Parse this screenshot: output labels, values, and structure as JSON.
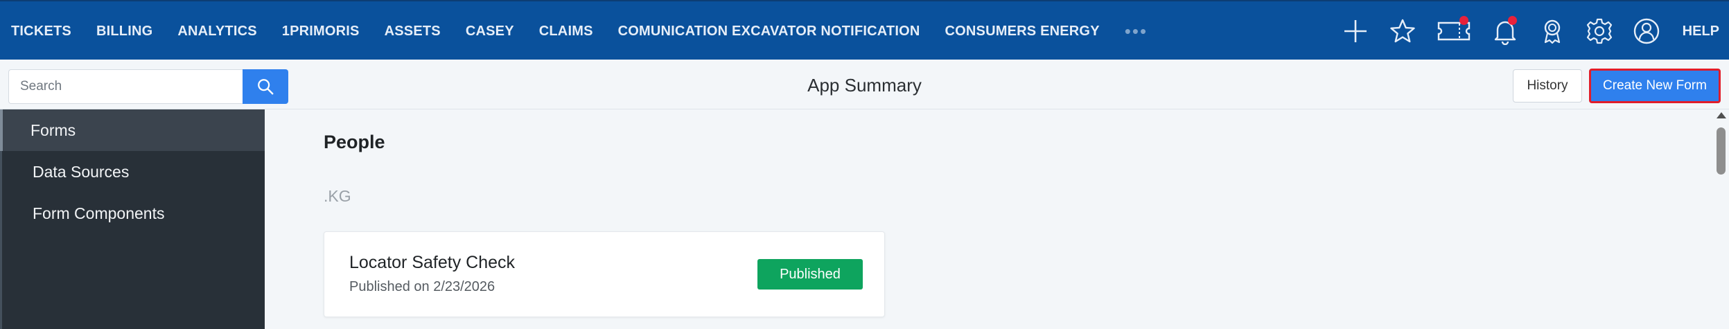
{
  "nav": {
    "items": [
      "TICKETS",
      "BILLING",
      "ANALYTICS",
      "1PRIMORIS",
      "ASSETS",
      "CASEY",
      "CLAIMS",
      "COMUNICATION EXCAVATOR NOTIFICATION",
      "CONSUMERS ENERGY"
    ],
    "more_icon": "ellipsis-icon",
    "icons": [
      "plus-icon",
      "star-icon",
      "ticket-icon",
      "bell-icon",
      "award-icon",
      "gear-icon",
      "user-icon"
    ],
    "help_label": "HELP",
    "accent_color": "#0a519c",
    "notification_color": "#e8213b"
  },
  "header": {
    "search_placeholder": "Search",
    "search_icon": "search-icon",
    "title": "App Summary",
    "history_label": "History",
    "create_label": "Create New Form",
    "primary_color": "#2f80ed",
    "highlight_color": "#e11d2a"
  },
  "sidebar": {
    "items": [
      {
        "label": "Forms",
        "active": true
      },
      {
        "label": "Data Sources",
        "active": false
      },
      {
        "label": "Form Components",
        "active": false
      }
    ]
  },
  "main": {
    "section_title": "People",
    "group_label": ".KG",
    "cards": [
      {
        "title": "Locator Safety Check",
        "subtitle": "Published on 2/23/2026",
        "status": "Published",
        "status_color": "#0ea45e"
      }
    ]
  }
}
